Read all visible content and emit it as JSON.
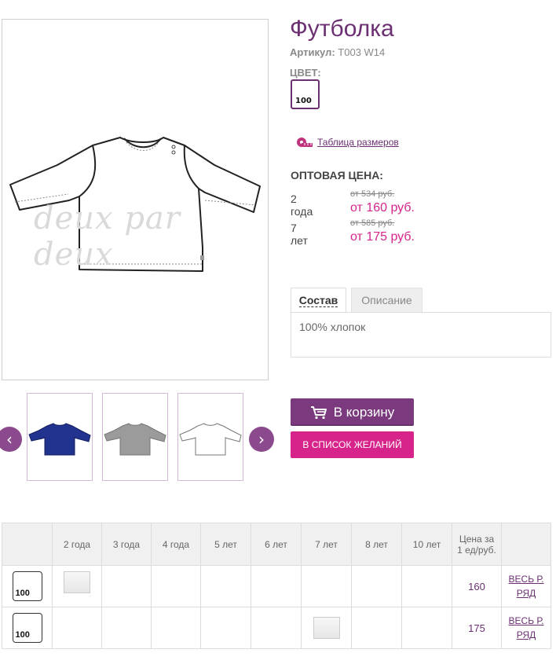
{
  "product": {
    "title": "Футболка",
    "article_label": "Артикул:",
    "article_value": "T003 W14",
    "color_label": "ЦВЕТ:",
    "color_code": "100",
    "size_table_link": "Таблица размеров",
    "watermark": "deux par deux"
  },
  "wholesale": {
    "label": "ОПТОВАЯ ЦЕНА:",
    "rows": [
      {
        "age": "2 года",
        "old_price": "от 534 руб.",
        "new_price": "от 160 руб."
      },
      {
        "age": "7 лет",
        "old_price": "от 585 руб.",
        "new_price": "от 175 руб."
      }
    ]
  },
  "tabs": {
    "composition": "Состав",
    "description": "Описание",
    "content": "100% хлопок"
  },
  "thumbnails": [
    {
      "name": "navy",
      "color": "#22328f"
    },
    {
      "name": "grey",
      "color": "#9b9b9b"
    },
    {
      "name": "white",
      "color": "#ffffff"
    }
  ],
  "buttons": {
    "cart": "В корзину",
    "wishlist": "В СПИСОК ЖЕЛАНИЙ",
    "prev": "‹",
    "next": "›"
  },
  "order_table": {
    "headers": [
      "2 года",
      "3 года",
      "4 года",
      "5 лет",
      "6 лет",
      "7 лет",
      "8 лет",
      "10 лет"
    ],
    "price_header": "Цена за 1 ед/руб.",
    "rows": [
      {
        "color_code": "100",
        "price": "160",
        "link": "ВЕСЬ Р. РЯД"
      },
      {
        "color_code": "100",
        "price": "175",
        "link": "ВЕСЬ Р. РЯД"
      }
    ]
  },
  "colors": {
    "brand_purple": "#6b2f72",
    "accent_pink": "#d6248a"
  }
}
